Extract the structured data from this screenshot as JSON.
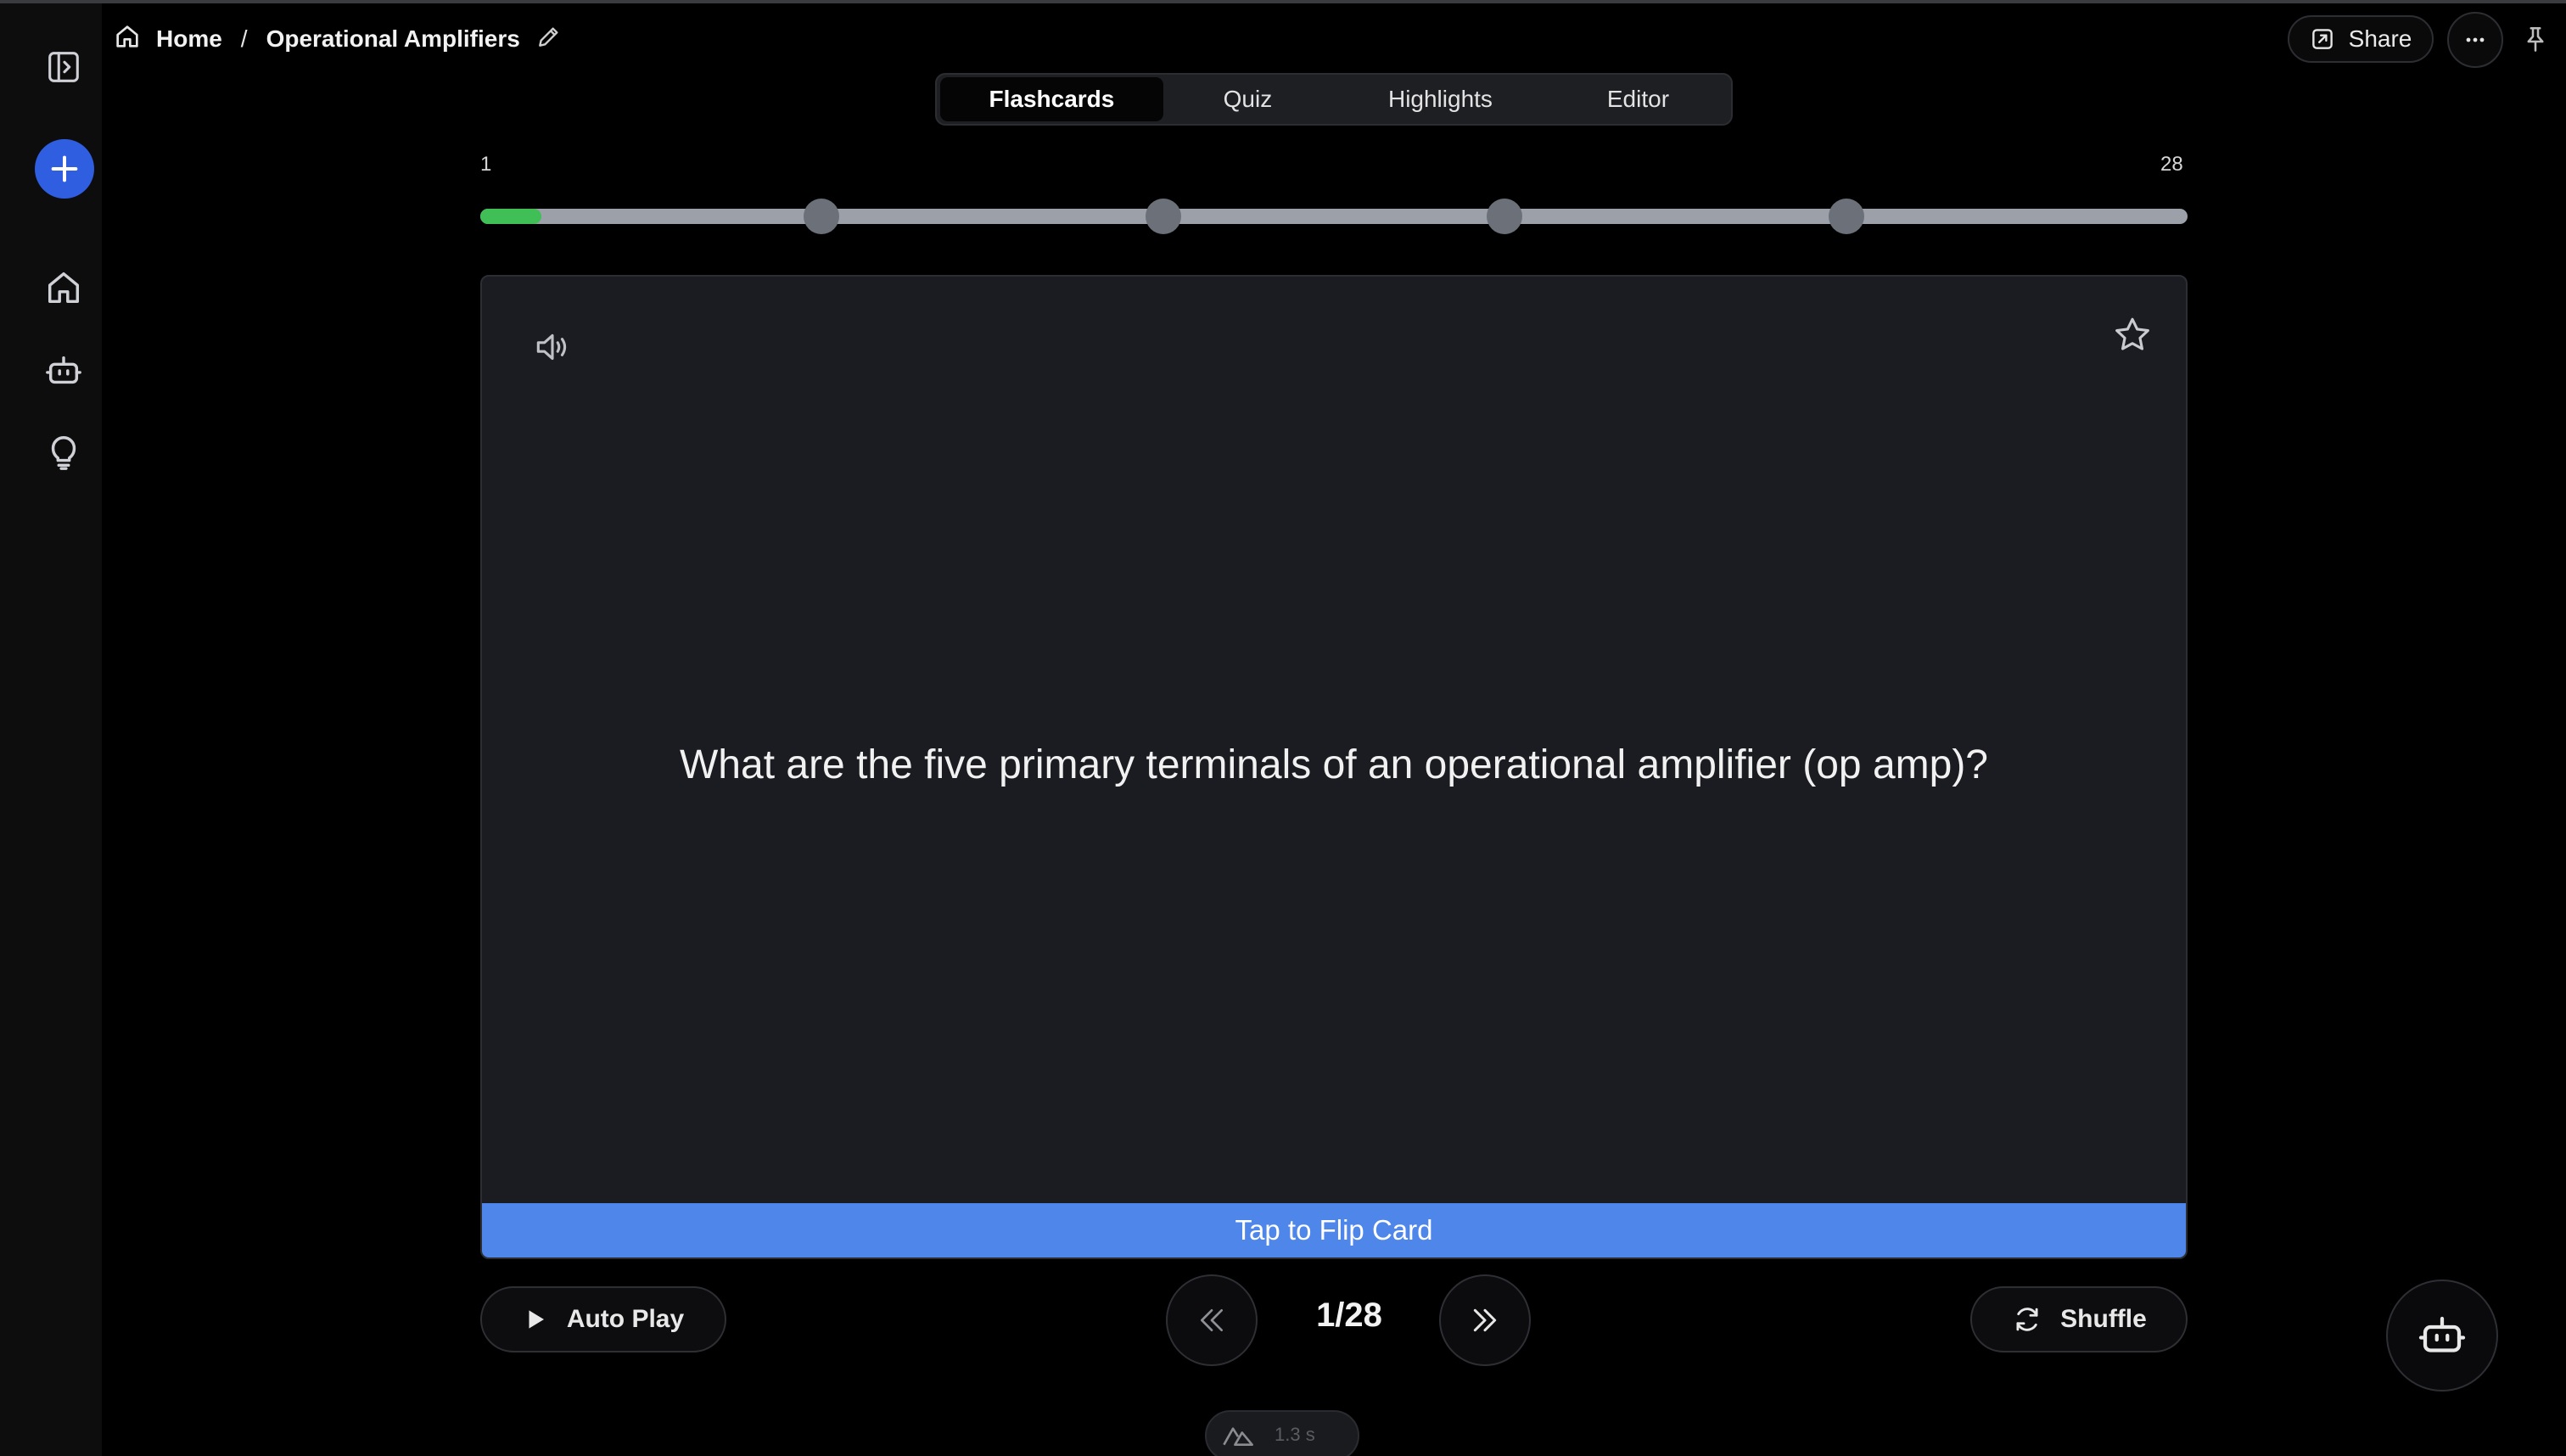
{
  "sidebar": {
    "items": [
      {
        "icon": "sidebar-toggle-icon"
      },
      {
        "icon": "plus-icon",
        "color": "#2f5fe0"
      },
      {
        "icon": "home-icon"
      },
      {
        "icon": "robot-icon"
      },
      {
        "icon": "lightbulb-icon"
      }
    ]
  },
  "breadcrumb": {
    "home_label": "Home",
    "separator": "/",
    "current_label": "Operational Amplifiers"
  },
  "header": {
    "share_label": "Share"
  },
  "tabs": [
    {
      "label": "Flashcards",
      "active": true
    },
    {
      "label": "Quiz",
      "active": false
    },
    {
      "label": "Highlights",
      "active": false
    },
    {
      "label": "Editor",
      "active": false
    }
  ],
  "progress": {
    "start_label": "1",
    "end_label": "28",
    "current": 1,
    "total": 28,
    "checkpoints": [
      0.2,
      0.4,
      0.6,
      0.8
    ],
    "fill_color": "#3fbf55"
  },
  "card": {
    "question": "What are the five primary terminals of an operational amplifier (op amp)?",
    "flip_label": "Tap to Flip Card",
    "flip_color": "#4f86ea"
  },
  "controls": {
    "autoplay_label": "Auto Play",
    "counter": "1/28",
    "shuffle_label": "Shuffle"
  },
  "devtools": {
    "time": "1.3 s"
  }
}
